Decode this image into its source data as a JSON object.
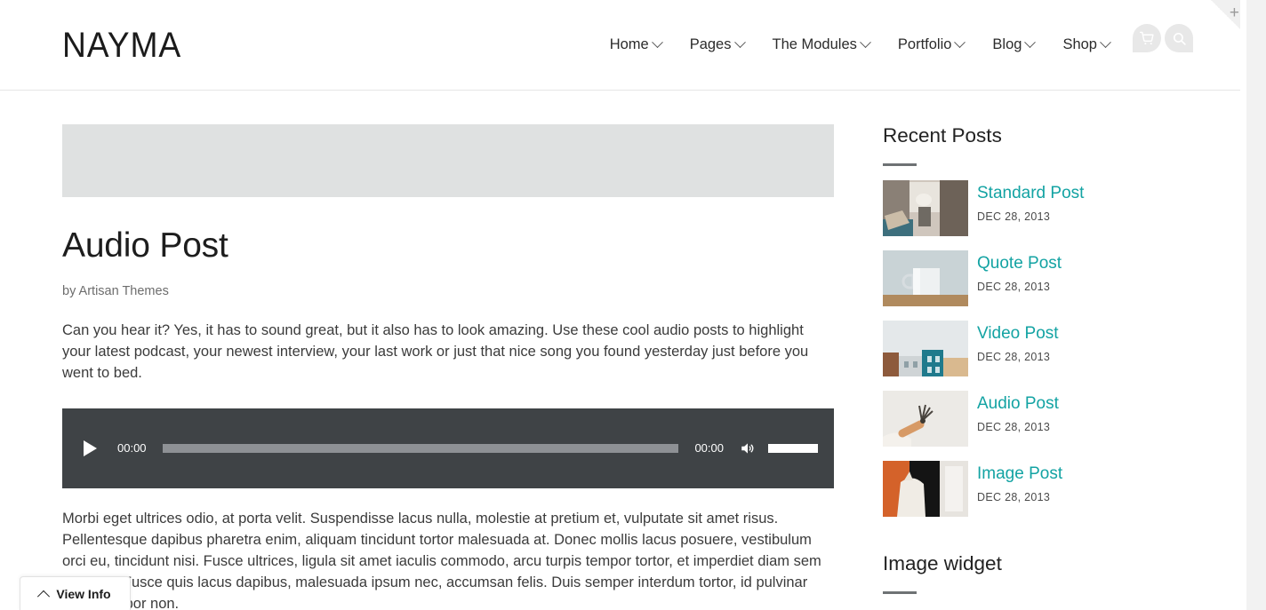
{
  "site": {
    "logo": "NAYMA",
    "corner_plus": "+"
  },
  "nav": {
    "items": [
      {
        "label": "Home",
        "has_dropdown": true
      },
      {
        "label": "Pages",
        "has_dropdown": true
      },
      {
        "label": "The Modules",
        "has_dropdown": true
      },
      {
        "label": "Portfolio",
        "has_dropdown": true
      },
      {
        "label": "Blog",
        "has_dropdown": true
      },
      {
        "label": "Shop",
        "has_dropdown": true
      }
    ],
    "icons": [
      {
        "name": "cart-icon"
      },
      {
        "name": "search-icon"
      }
    ]
  },
  "article": {
    "title": "Audio Post",
    "byline": "by Artisan Themes",
    "paragraph_1": "Can you hear it? Yes, it has to sound great, but it also has to look amazing. Use these cool audio posts to highlight your latest podcast, your newest interview, your last work or just that nice song you found yesterday just before you went to bed.",
    "paragraph_2": "Morbi eget ultrices odio, at porta velit. Suspendisse lacus nulla, molestie at pretium et, vulputate sit amet risus. Pellentesque dapibus pharetra enim, aliquam tincidunt tortor malesuada at. Donec mollis lacus posuere, vestibulum orci eu, tincidunt nisi. Fusce ultrices, ligula sit amet iaculis commodo, arcu turpis tempor tortor, et imperdiet diam sem in quam. Fusce quis lacus dapibus, malesuada ipsum nec, accumsan felis. Duis semper interdum tortor, id pulvinar tortor tempor non."
  },
  "audio_player": {
    "play_label": "Play",
    "current_time": "00:00",
    "total_time": "00:00",
    "mute_label": "Mute",
    "progress_percent": 0,
    "volume_percent": 100
  },
  "sidebar": {
    "widgets": [
      {
        "title": "Recent Posts",
        "posts": [
          {
            "title": "Standard Post",
            "date": "DEC 28, 2013"
          },
          {
            "title": "Quote Post",
            "date": "DEC 28, 2013"
          },
          {
            "title": "Video Post",
            "date": "DEC 28, 2013"
          },
          {
            "title": "Audio Post",
            "date": "DEC 28, 2013"
          },
          {
            "title": "Image Post",
            "date": "DEC 28, 2013"
          }
        ]
      },
      {
        "title": "Image widget"
      }
    ]
  },
  "view_info": {
    "label": "View Info"
  },
  "colors": {
    "accent": "#13a3a3",
    "player_bg": "#3f4346",
    "placeholder": "#dfe1e1",
    "text": "#3b3b3b"
  }
}
